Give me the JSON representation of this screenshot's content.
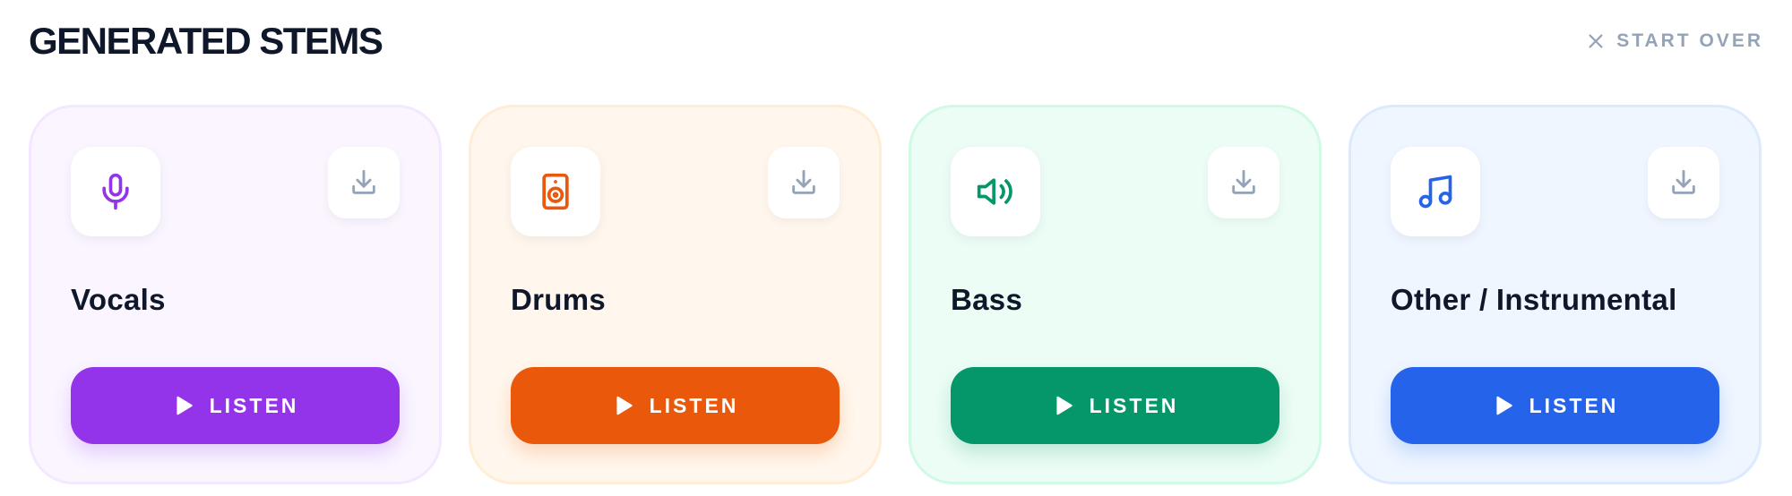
{
  "header": {
    "title": "GENERATED STEMS",
    "start_over_label": "START OVER",
    "start_over_icon": "close-icon"
  },
  "colors": {
    "title": "#0f172a",
    "muted": "#94a3b8"
  },
  "stems": [
    {
      "name": "Vocals",
      "icon": "microphone-icon",
      "listen_label": "LISTEN",
      "download_icon": "download-icon",
      "accent": "#9333ea",
      "card_bg": "#faf5ff",
      "card_border": "#f3e8ff"
    },
    {
      "name": "Drums",
      "icon": "speaker-icon",
      "listen_label": "LISTEN",
      "download_icon": "download-icon",
      "accent": "#ea580c",
      "card_bg": "#fff7ed",
      "card_border": "#ffedd5"
    },
    {
      "name": "Bass",
      "icon": "volume-icon",
      "listen_label": "LISTEN",
      "download_icon": "download-icon",
      "accent": "#059669",
      "card_bg": "#ecfdf5",
      "card_border": "#d1fae5"
    },
    {
      "name": "Other / Instrumental",
      "icon": "music-note-icon",
      "listen_label": "LISTEN",
      "download_icon": "download-icon",
      "accent": "#2563eb",
      "card_bg": "#eff6ff",
      "card_border": "#dbeafe"
    }
  ]
}
